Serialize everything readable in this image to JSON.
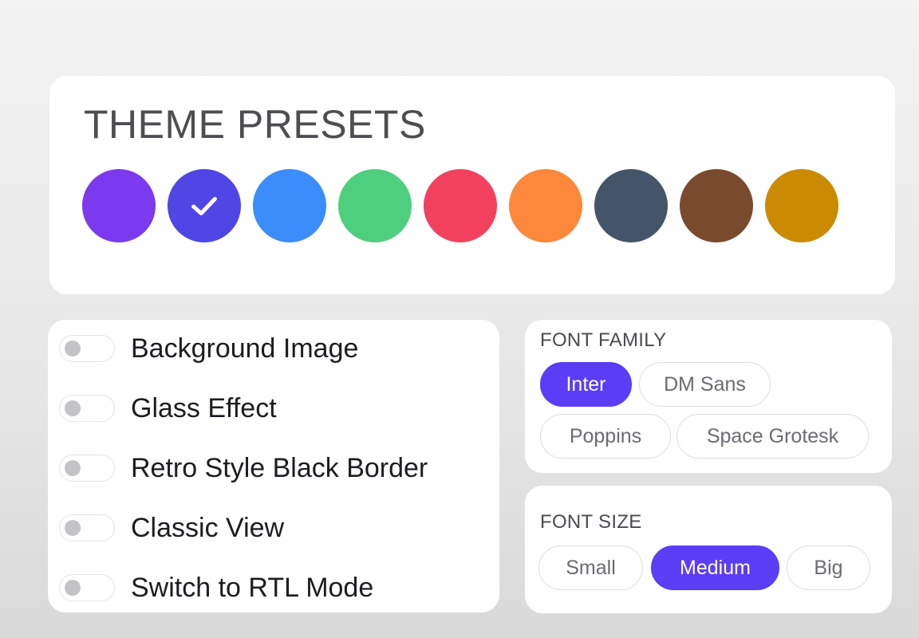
{
  "theme_presets": {
    "title": "THEME PRESETS",
    "swatches": [
      {
        "icon": "",
        "color": "#7b3aee",
        "selected": false
      },
      {
        "icon": "check-icon",
        "color": "#4f46e5",
        "selected": true
      },
      {
        "icon": "",
        "color": "#3a8dfb",
        "selected": false
      },
      {
        "icon": "",
        "color": "#4ecf7d",
        "selected": false
      },
      {
        "icon": "",
        "color": "#f2415e",
        "selected": false
      },
      {
        "icon": "",
        "color": "#fc883c",
        "selected": false
      },
      {
        "icon": "",
        "color": "#455569",
        "selected": false
      },
      {
        "icon": "",
        "color": "#7a4a2e",
        "selected": false
      },
      {
        "icon": "",
        "color": "#cb8a03",
        "selected": false
      }
    ]
  },
  "toggles": [
    {
      "label": "Background Image",
      "on": false
    },
    {
      "label": "Glass Effect",
      "on": false
    },
    {
      "label": "Retro Style Black Border",
      "on": false
    },
    {
      "label": "Classic View",
      "on": false
    },
    {
      "label": "Switch to RTL Mode",
      "on": false
    }
  ],
  "font_family": {
    "label": "FONT FAMILY",
    "options": [
      "Inter",
      "DM Sans",
      "Poppins",
      "Space Grotesk"
    ],
    "selected": "Inter"
  },
  "font_size": {
    "label": "FONT SIZE",
    "options": [
      "Small",
      "Medium",
      "Big"
    ],
    "selected": "Medium"
  },
  "colors": {
    "accent": "#5b3df5",
    "card": "#ffffff",
    "toggle_knob": "#c4c4c8"
  }
}
